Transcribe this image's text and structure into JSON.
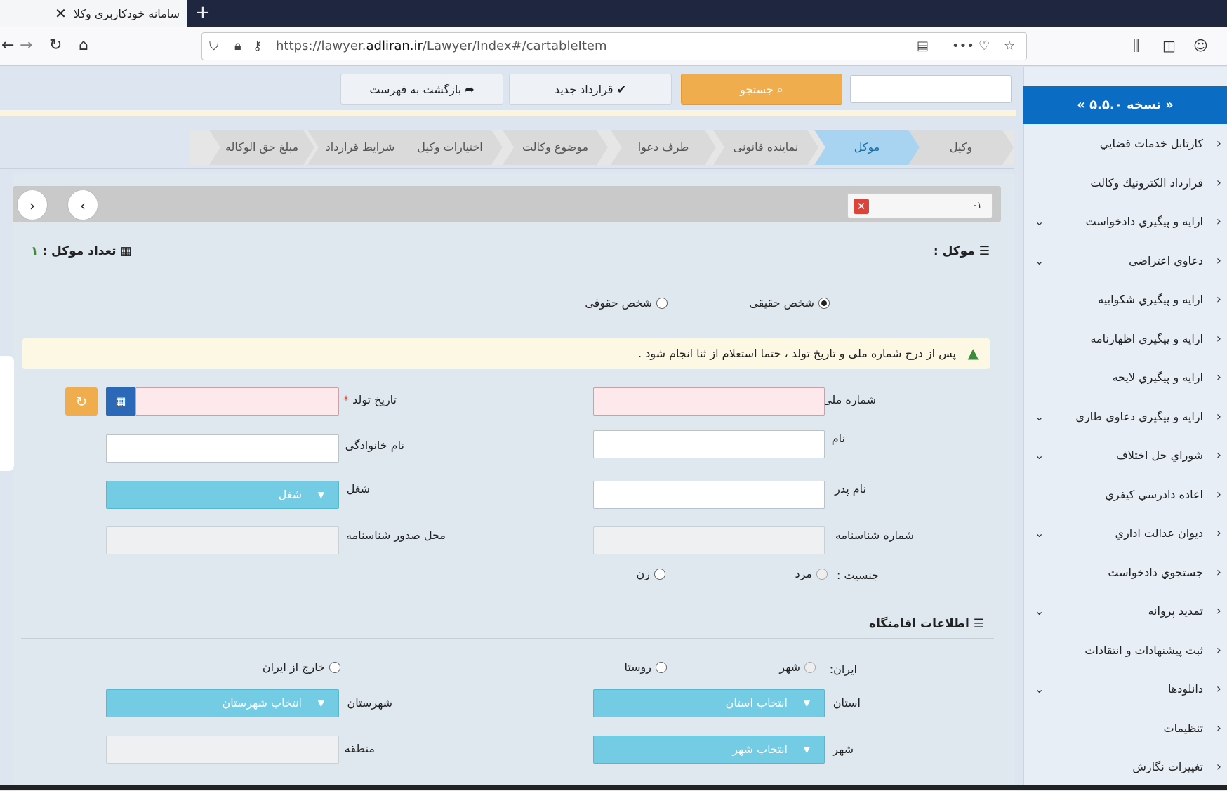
{
  "browser": {
    "tab_title": "سامانه خودکاربری وکلا",
    "tab_close": "✕",
    "new_tab": "+",
    "url_prefix": "https://lawyer.",
    "url_domain": "adliran.ir",
    "url_path": "/Lawyer/Index#/cartableItem"
  },
  "toolbar": {
    "search_label": "جستجو",
    "new_contract_label": "قرارداد جدید",
    "back_label": "بازگشت به فهرست"
  },
  "sidebar": {
    "version": "« نسخه ۵.۵.۰ »",
    "items": [
      {
        "label": "کارتابل خدمات قضايي",
        "dropdown": false
      },
      {
        "label": "قرارداد الکترونيك وكالت",
        "dropdown": false
      },
      {
        "label": "ارايه و پيگيري دادخواست",
        "dropdown": true
      },
      {
        "label": "دعاوي اعتراضي",
        "dropdown": true
      },
      {
        "label": "ارايه و پيگيري شکواييه",
        "dropdown": false
      },
      {
        "label": "ارايه و پيگيري اظهارنامه",
        "dropdown": false
      },
      {
        "label": "ارايه و پيگيري لايحه",
        "dropdown": false
      },
      {
        "label": "ارايه و پيگيري دعاوي طاري",
        "dropdown": true
      },
      {
        "label": "شوراي حل اختلاف",
        "dropdown": true
      },
      {
        "label": "اعاده دادرسي كيفري",
        "dropdown": false
      },
      {
        "label": "ديوان عدالت اداري",
        "dropdown": true
      },
      {
        "label": "جستجوي دادخواست",
        "dropdown": false
      },
      {
        "label": "تمديد پروانه",
        "dropdown": true
      },
      {
        "label": "ثبت پيشنهادات و انتقادات",
        "dropdown": false
      },
      {
        "label": "دانلودها",
        "dropdown": true
      },
      {
        "label": "تنظیمات",
        "dropdown": false
      },
      {
        "label": "تغییرات نگارش",
        "dropdown": false
      }
    ]
  },
  "wizard": {
    "steps": [
      "وکیل",
      "موکل",
      "نماینده قانونی",
      "طرف دعوا",
      "موضوع وکالت",
      "اختیارات وکیل",
      "شرایط قرارداد",
      "مبلغ حق الوکاله"
    ],
    "active": "موکل"
  },
  "record": {
    "number": "۱-"
  },
  "client": {
    "section_title": "موکل :",
    "count_label": "تعداد موکل :",
    "count_value": "۱",
    "type_natural": "شخص حقیقی",
    "type_legal": "شخص حقوقی",
    "warning": "پس از درج شماره ملی و تاریخ تولد ، حتما استعلام از ثنا انجام شود .",
    "national_id_label": "شماره ملی",
    "birth_date_label": "تاریخ تولد",
    "first_name_label": "نام",
    "last_name_label": "نام خانوادگی",
    "father_name_label": "نام پدر",
    "job_label": "شغل",
    "job_value": "شغل",
    "id_number_label": "شماره شناسنامه",
    "id_issue_place_label": "محل صدور شناسنامه",
    "gender_label": "جنسیت :",
    "gender_male": "مرد",
    "gender_female": "زن"
  },
  "residence": {
    "section_title": "اطلاعات اقامتگاه",
    "iran_label": "ایران:",
    "city_option": "شهر",
    "village_option": "روستا",
    "abroad_option": "خارج از ایران",
    "province_label": "استان",
    "province_value": "انتخاب استان",
    "county_label": "شهرستان",
    "county_value": "انتخاب شهرستان",
    "city_label": "شهر",
    "city_value": "انتخاب شهر",
    "region_label": "منطقه"
  },
  "colors": {
    "accent": "#0b6cc4",
    "search_btn": "#f0ad4e",
    "select_bg": "#73cce3",
    "active_step": "#a8d4f2"
  }
}
